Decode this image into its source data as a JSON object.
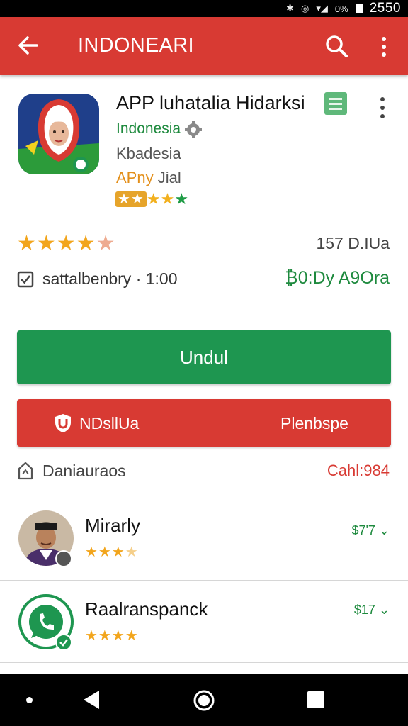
{
  "status_bar": {
    "signal_text": "0%",
    "time": "2550"
  },
  "app_bar": {
    "title": "INDONEARI"
  },
  "app": {
    "name": "APP luhatalia Hidarksi",
    "developer": "Indonesia",
    "category": "Kbadesia",
    "subtitle_accent": "APny",
    "subtitle_rest": " Jial",
    "mini_rating_box": "★★",
    "mini_rating_stars": "★★",
    "mini_rating_green": "★"
  },
  "rating": {
    "stars_full": "★★★★",
    "stars_dim": "★",
    "value": 4.5,
    "count": "157 D.IUa"
  },
  "info": {
    "text": "sattalbenbry ·  1:00",
    "price": "₿0:Dy A9Ora"
  },
  "buttons": {
    "install_label": "Undul",
    "secondary_left": "NDsllUa",
    "secondary_right": "Plenbspe"
  },
  "downloads": {
    "label": "Daniauraos",
    "value": "Cahl:984"
  },
  "list": [
    {
      "title": "Mirarly",
      "stars_full": "★★★",
      "stars_dim": "★",
      "rating": 3.5,
      "price": "$7'7 ⌄"
    },
    {
      "title": "Raalranspanck",
      "stars_full": "★★★★",
      "stars_dim": "",
      "rating": 4,
      "price": "$17 ⌄"
    }
  ],
  "colors": {
    "primary_red": "#d83a33",
    "install_green": "#1e9650",
    "star_orange": "#f2a51c",
    "developer_green": "#1e8a3e"
  },
  "icons": [
    "back-arrow-icon",
    "search-icon",
    "more-vert-icon",
    "gear-icon",
    "checkbox-icon",
    "shield-icon",
    "download-icon",
    "whatsapp-icon",
    "verified-icon",
    "nav-back-icon",
    "nav-home-icon",
    "nav-recent-icon"
  ]
}
